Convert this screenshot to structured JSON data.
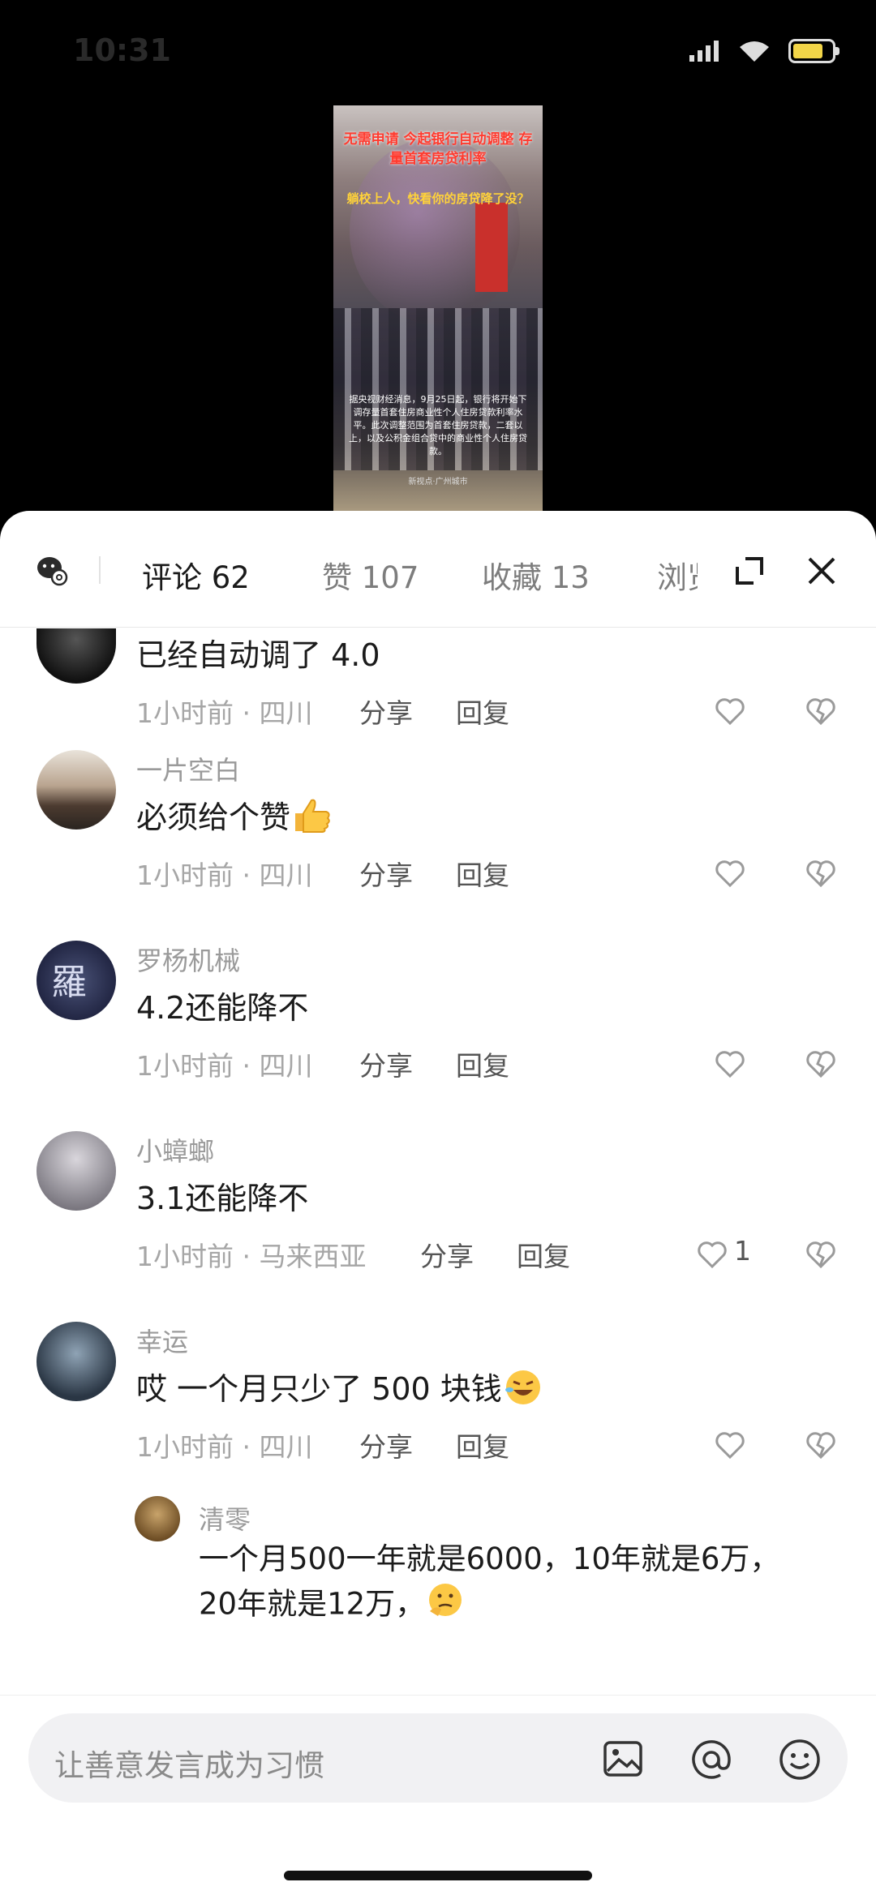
{
  "status_bar": {
    "time": "10:31"
  },
  "video": {
    "title": "无需申请 今起银行自动调整 存量首套房贷利率",
    "subtitle": "躺校上人，快看你的房贷降了没？",
    "caption": "据央视财经消息，9月25日起，银行将开始下调存量首套住房商业性个人住房贷款利率水平。此次调整范围为首套住房贷款，二套以上，以及公积金组合贷中的商业性个人住房贷款。",
    "credit": "新视点·广州城市"
  },
  "tabs": {
    "comments": "评论 62",
    "likes": "赞 107",
    "favorites": "收藏 13",
    "views": "浏览"
  },
  "comments": [
    {
      "text": "已经自动调了 4.0",
      "meta": "1小时前 · 四川",
      "share": "分享",
      "reply": "回复"
    },
    {
      "user": "一片空白",
      "text": "必须给个赞",
      "meta": "1小时前 · 四川",
      "share": "分享",
      "reply": "回复"
    },
    {
      "user": "罗杨机械",
      "text": "4.2还能降不",
      "meta": "1小时前 · 四川",
      "share": "分享",
      "reply": "回复"
    },
    {
      "user": "小蟑螂",
      "text": "3.1还能降不",
      "meta": "1小时前 · 马来西亚",
      "share": "分享",
      "reply": "回复",
      "likes": "1"
    },
    {
      "user": "幸运",
      "text": "哎 一个月只少了 500 块钱",
      "meta": "1小时前 · 四川",
      "share": "分享",
      "reply": "回复"
    }
  ],
  "reply": {
    "user": "清零",
    "text": "一个月500一年就是6000，10年就是6万，20年就是12万，"
  },
  "input": {
    "placeholder": "让善意发言成为习惯"
  },
  "colors": {
    "battery": "#f2d548",
    "sheet_bg": "#ffffff",
    "input_bg": "#f1f1f3"
  }
}
